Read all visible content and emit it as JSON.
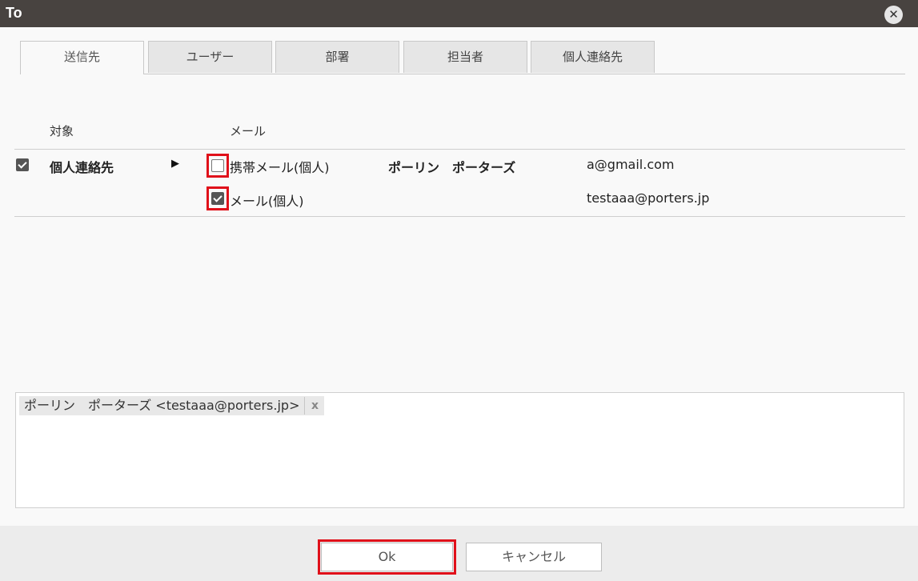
{
  "window": {
    "title": "To",
    "close_icon": "close-icon"
  },
  "tabs": [
    {
      "label": "送信先",
      "active": true
    },
    {
      "label": "ユーザー",
      "active": false
    },
    {
      "label": "部署",
      "active": false
    },
    {
      "label": "担当者",
      "active": false
    },
    {
      "label": "個人連絡先",
      "active": false
    }
  ],
  "table": {
    "headers": {
      "target": "対象",
      "mail": "メール"
    },
    "row": {
      "checked": true,
      "target": "個人連絡先",
      "expand_icon": "triangle-right-icon",
      "options": [
        {
          "label": "携帯メール(個人)",
          "checked": false,
          "name": "ポーリン　ポーターズ",
          "email": "a@gmail.com"
        },
        {
          "label": "メール(個人)",
          "checked": true,
          "name": "",
          "email": "testaaa@porters.jp"
        }
      ]
    }
  },
  "recipients": {
    "chips": [
      {
        "label": "ポーリン　ポーターズ <testaaa@porters.jp>",
        "remove": "x"
      }
    ]
  },
  "footer": {
    "ok_label": "Ok",
    "cancel_label": "キャンセル"
  },
  "colors": {
    "titlebar": "#484340",
    "highlight": "#e0101a"
  }
}
